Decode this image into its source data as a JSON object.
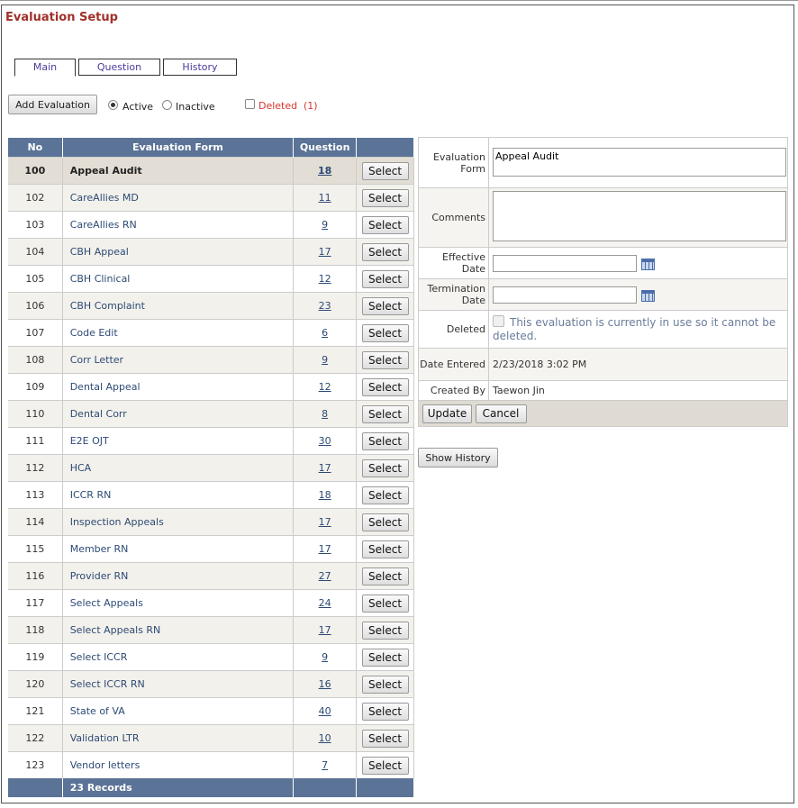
{
  "page": {
    "title": "Evaluation Setup"
  },
  "tabs": [
    {
      "label": "Main"
    },
    {
      "label": "Question"
    },
    {
      "label": "History"
    }
  ],
  "toolbar": {
    "add_label": "Add Evaluation",
    "active_label": "Active",
    "inactive_label": "Inactive",
    "deleted_label": "Deleted",
    "deleted_count": "(1)"
  },
  "grid": {
    "headers": {
      "no": "No",
      "form": "Evaluation Form",
      "question": "Question"
    },
    "select_label": "Select",
    "rows": [
      {
        "no": "100",
        "form": "Appeal Audit",
        "q": "18"
      },
      {
        "no": "102",
        "form": "CareAllies MD",
        "q": "11"
      },
      {
        "no": "103",
        "form": "CareAllies RN",
        "q": "9"
      },
      {
        "no": "104",
        "form": "CBH Appeal",
        "q": "17"
      },
      {
        "no": "105",
        "form": "CBH Clinical",
        "q": "12"
      },
      {
        "no": "106",
        "form": "CBH Complaint",
        "q": "23"
      },
      {
        "no": "107",
        "form": "Code Edit",
        "q": "6"
      },
      {
        "no": "108",
        "form": "Corr Letter",
        "q": "9"
      },
      {
        "no": "109",
        "form": "Dental Appeal",
        "q": "12"
      },
      {
        "no": "110",
        "form": "Dental Corr",
        "q": "8"
      },
      {
        "no": "111",
        "form": "E2E OJT",
        "q": "30"
      },
      {
        "no": "112",
        "form": "HCA",
        "q": "17"
      },
      {
        "no": "113",
        "form": "ICCR RN",
        "q": "18"
      },
      {
        "no": "114",
        "form": "Inspection Appeals",
        "q": "17"
      },
      {
        "no": "115",
        "form": "Member RN",
        "q": "17"
      },
      {
        "no": "116",
        "form": "Provider RN",
        "q": "27"
      },
      {
        "no": "117",
        "form": "Select Appeals",
        "q": "24"
      },
      {
        "no": "118",
        "form": "Select Appeals RN",
        "q": "17"
      },
      {
        "no": "119",
        "form": "Select ICCR",
        "q": "9"
      },
      {
        "no": "120",
        "form": "Select ICCR RN",
        "q": "16"
      },
      {
        "no": "121",
        "form": "State of VA",
        "q": "40"
      },
      {
        "no": "122",
        "form": "Validation LTR",
        "q": "10"
      },
      {
        "no": "123",
        "form": "Vendor letters",
        "q": "7"
      }
    ],
    "footer": "23 Records"
  },
  "detail": {
    "form_label": "Evaluation Form",
    "form_value": "Appeal Audit",
    "comments_label": "Comments",
    "comments_value": "",
    "effective_label": "Effective Date",
    "termination_label": "Termination Date",
    "deleted_label": "Deleted",
    "deleted_note": "This evaluation is currently in use so it cannot be deleted.",
    "entered_label": "Date Entered",
    "entered_value": "2/23/2018 3:02 PM",
    "created_label": "Created By",
    "created_value": "Taewon Jin",
    "update_label": "Update",
    "cancel_label": "Cancel",
    "show_history_label": "Show History"
  }
}
